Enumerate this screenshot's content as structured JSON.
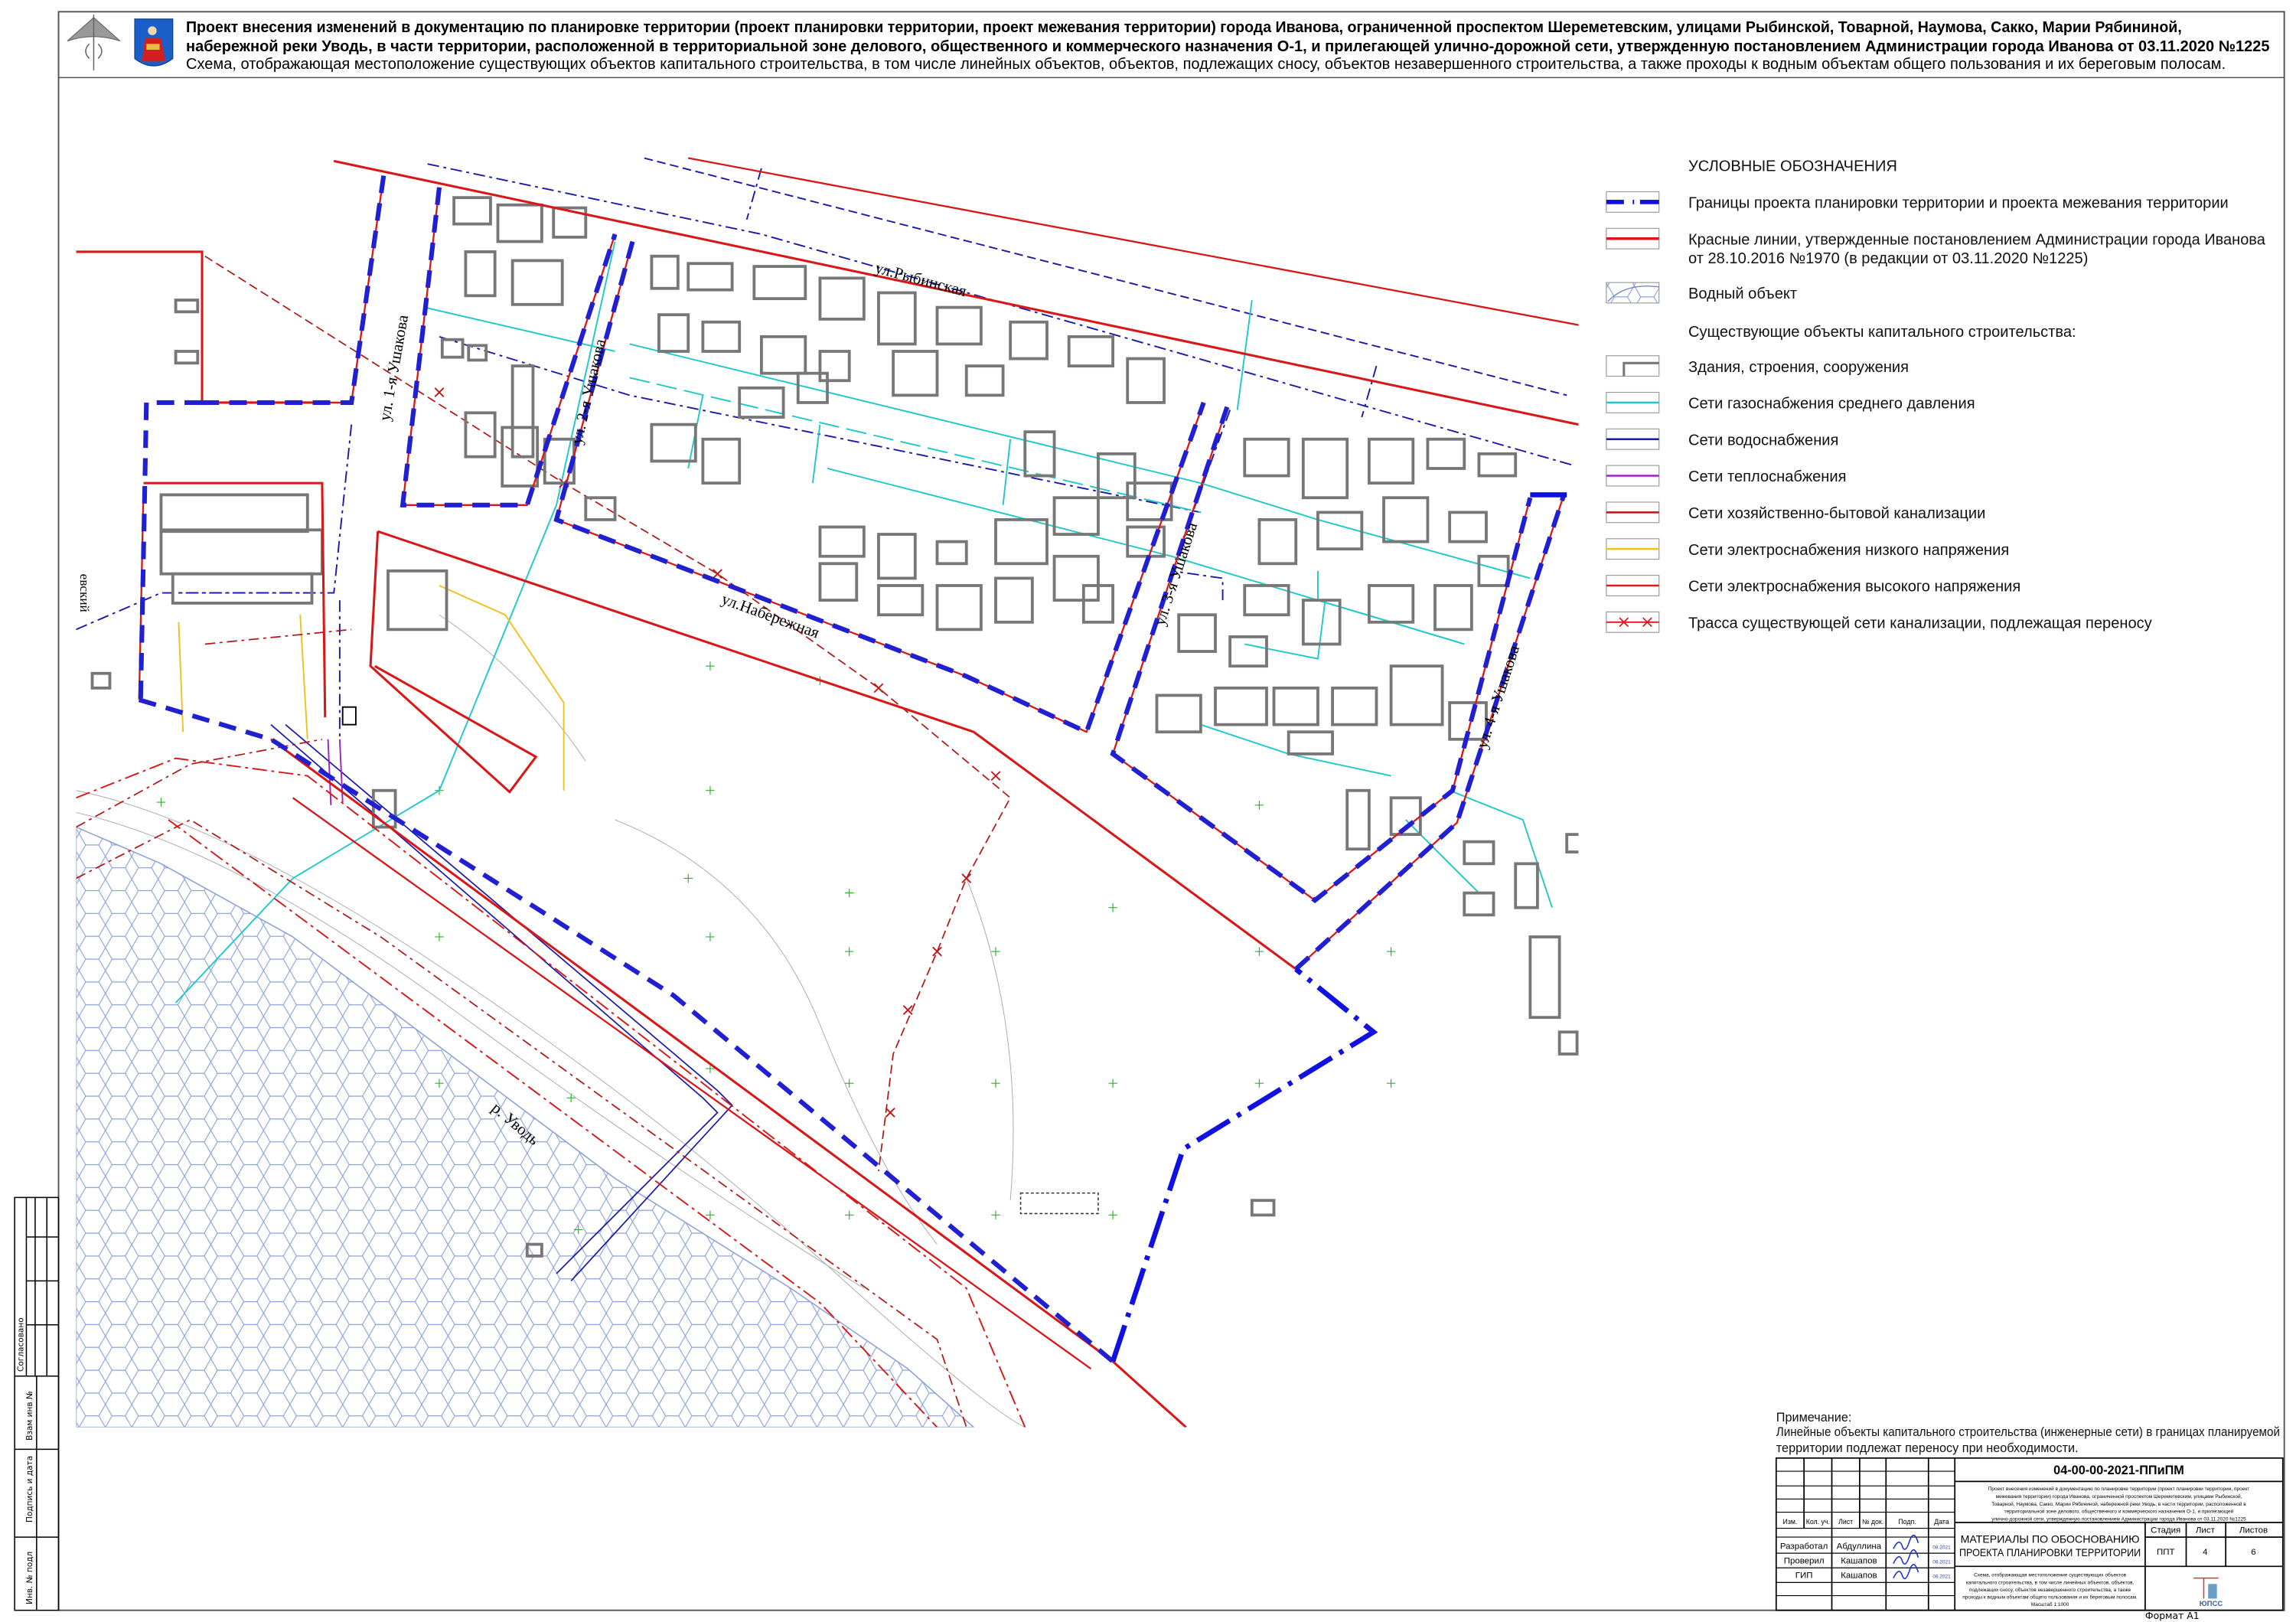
{
  "header": {
    "line1": "Проект внесения изменений в документацию по планировке территории (проект планировки территории, проект межевания территории) города Иванова, ограниченной проспектом Шереметевским, улицами Рыбинской, Товарной, Наумова, Сакко, Марии Рябининой,",
    "line2": "набережной реки Уводь, в части территории, расположенной в территориальной зоне делового, общественного и коммерческого назначения О-1, и прилегающей улично-дорожной сети, утвержденную постановлением Администрации города Иванова от 03.11.2020 №1225",
    "line3": "Схема, отображающая местоположение существующих объектов капитального строительства, в том числе линейных объектов, объектов, подлежащих сносу, объектов незавершенного строительства, а также проходы к водным объектам общего пользования и их береговым полосам."
  },
  "legend": {
    "title": "УСЛОВНЫЕ ОБОЗНАЧЕНИЯ",
    "items": [
      {
        "label": "Границы проекта планировки территории и проекта межевания территории",
        "symbol": "boundary"
      },
      {
        "label": "Красные линии, утвержденные постановлением Администрации города Иванова",
        "label2": "от 28.10.2016 №1970 (в редакции от 03.11.2020 №1225)",
        "symbol": "red-line"
      },
      {
        "label": "Водный объект",
        "symbol": "water"
      },
      {
        "label": "Существующие объекты капитального строительства:",
        "symbol": "none"
      },
      {
        "label": "Здания, строения, сооружения",
        "symbol": "building"
      },
      {
        "label": "Сети газоснабжения среднего давления",
        "symbol": "line",
        "color": "#20c8c8"
      },
      {
        "label": "Сети водоснабжения",
        "symbol": "line",
        "color": "#1a1aa8"
      },
      {
        "label": "Сети теплоснабжения",
        "symbol": "line",
        "color": "#a020c8"
      },
      {
        "label": "Сети хозяйственно-бытовой канализации",
        "symbol": "line",
        "color": "#b01818"
      },
      {
        "label": "Сети электроснабжения низкого напряжения",
        "symbol": "line",
        "color": "#f0c020"
      },
      {
        "label": "Сети электроснабжения высокого напряжения",
        "symbol": "line",
        "color": "#e01818"
      },
      {
        "label": "Трасса существующей сети канализации, подлежащая переносу",
        "symbol": "cross-line"
      }
    ]
  },
  "streets": {
    "ushakova1": "ул. 1-я Ушакова",
    "ushakova2": "ул. 2-я Ушакова",
    "ushakova3": "ул. 3-я Ушакова",
    "ushakova4": "ул. 4-я Ушакова",
    "rybinskaya": "ул.Рыбинская",
    "naberezhnaya": "ул.Набережная",
    "river": "р. Уводь",
    "sheremetevsky_fragment": "евский"
  },
  "note": {
    "title": "Примечание:",
    "line1": "Линейные объекты капитального строительства (инженерные сети) в границах планируемой",
    "line2": "территории подлежат переносу при необходимости."
  },
  "title_block": {
    "code": "04-00-00-2021-ППиПМ",
    "project_lines": [
      "Проект внесения изменений в документацию по планировке территории (проект планировки территории, проект",
      "межевания территории) города Иванова, ограниченной проспектом Шереметевским, улицами Рыбинской,",
      "Товарной, Наумова, Сакко, Марии Рябининой, набережной реки Уводь, в части территории, расположенной в",
      "территориальной зоне делового, общественного и коммерческого назначения О-1, и прилегающей",
      "улично-дорожной сети, утвержденную постановлением Администрации города Иванова от 03.11.2020 №1225"
    ],
    "columns": [
      "Изм.",
      "Кол. уч.",
      "Лист",
      "№ док.",
      "Подп.",
      "Дата"
    ],
    "people": [
      {
        "role": "Разработал",
        "name": "Абдуллина",
        "date": "08.2021"
      },
      {
        "role": "Проверил",
        "name": "Кашапов",
        "date": "08.2021"
      },
      {
        "role": "ГИП",
        "name": "Кашапов",
        "date": "08.2021"
      }
    ],
    "section_line1": "МАТЕРИАЛЫ ПО ОБОСНОВАНИЮ",
    "section_line2": "ПРОЕКТА ПЛАНИРОВКИ ТЕРРИТОРИИ",
    "stage_label": "Стадия",
    "sheet_label": "Лист",
    "sheets_label": "Листов",
    "stage": "ППТ",
    "sheet": "4",
    "sheets": "6",
    "scheme_lines": [
      "Схема, отображающая местоположение существующих объектов",
      "капитального строительства, в том числе линейных объектов, объектов,",
      "подлежащих сносу, объектов незавершенного строительства, а также",
      "проходы к водным объектам общего пользования и их береговым полосам.",
      "Масштаб 1:1000"
    ],
    "company_logo": "ЮПСС",
    "format": "Формат А1"
  },
  "side_stamp": {
    "agreed": "Согласовано",
    "replace_inv": "Взам инв №",
    "sign_date": "Подпись и дата",
    "inv_orig": "Инв. № подл"
  },
  "colors": {
    "boundary_blue": "#1010e0",
    "red_line": "#d81818",
    "gas": "#20c8c8",
    "water": "#1a1aa8",
    "heat": "#a020c8",
    "power_low": "#f0c020",
    "building": "#777777"
  }
}
